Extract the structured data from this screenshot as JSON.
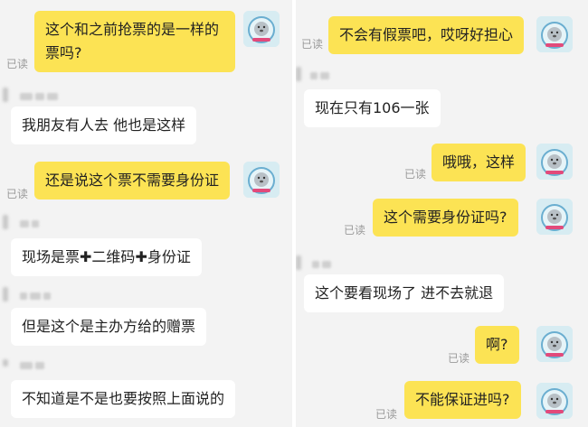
{
  "read_label": "已读",
  "left": {
    "messages": [
      {
        "from": "me",
        "text": "这个和之前抢票的是一样的票吗?"
      },
      {
        "from": "other",
        "text": "我朋友有人去 他也是这样"
      },
      {
        "from": "me",
        "text": "还是说这个票不需要身份证"
      },
      {
        "from": "other",
        "text_parts": [
          "现场是票",
          "✚",
          "二维码",
          "✚",
          "身份证"
        ]
      },
      {
        "from": "other",
        "text": "但是这个是主办方给的赠票"
      },
      {
        "from": "other",
        "text": "不知道是不是也要按照上面说的"
      }
    ]
  },
  "right": {
    "messages": [
      {
        "from": "me",
        "text": "不会有假票吧，哎呀好担心"
      },
      {
        "from": "other",
        "text": "现在只有106一张"
      },
      {
        "from": "me",
        "text": "哦哦，这样"
      },
      {
        "from": "me",
        "text": "这个需要身份证吗?"
      },
      {
        "from": "other",
        "text": "这个要看现场了 进不去就退"
      },
      {
        "from": "me",
        "text": "啊?"
      },
      {
        "from": "me",
        "text": "不能保证进吗?"
      }
    ]
  },
  "colors": {
    "my_bubble": "#fce354",
    "other_bubble": "#ffffff",
    "background": "#f3f3f3"
  },
  "avatar_icon": "seal-avatar-icon"
}
